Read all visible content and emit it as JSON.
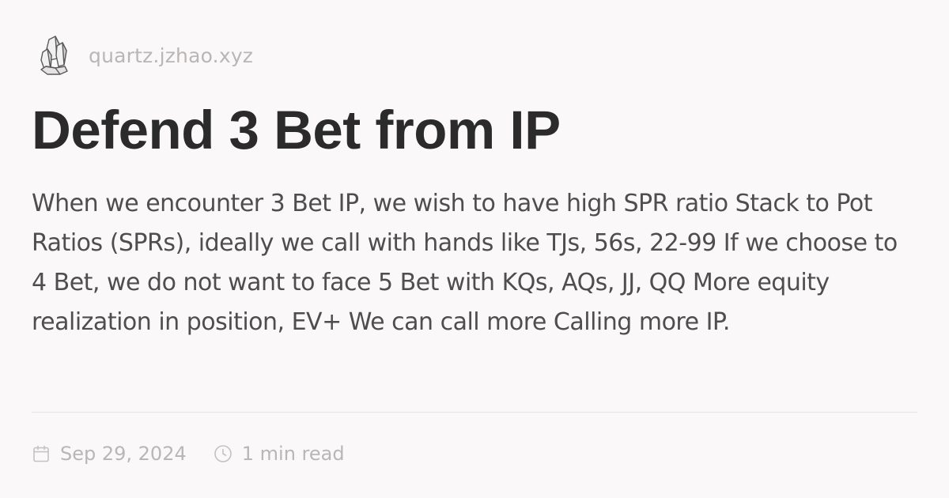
{
  "site": {
    "name": "quartz.jzhao.xyz",
    "logo_icon": "crystal-cluster-icon"
  },
  "article": {
    "title": "Defend 3 Bet from IP",
    "description": "When we encounter 3 Bet IP, we wish to have high SPR ratio Stack to Pot Ratios (SPRs), ideally we call with hands like TJs, 56s, 22-99 If we choose to 4 Bet, we do not want to face 5 Bet with KQs, AQs, JJ, QQ More equity realization in position, EV+ We can call more Calling more IP."
  },
  "meta": {
    "date": "Sep 29, 2024",
    "date_icon": "calendar-icon",
    "read_time": "1 min read",
    "read_time_icon": "clock-icon"
  },
  "colors": {
    "background": "#faf8f8",
    "title": "#2b2b2b",
    "body_text": "#4e4e4e",
    "muted_text": "#b9b6b6",
    "divider": "#e8e5e5"
  }
}
